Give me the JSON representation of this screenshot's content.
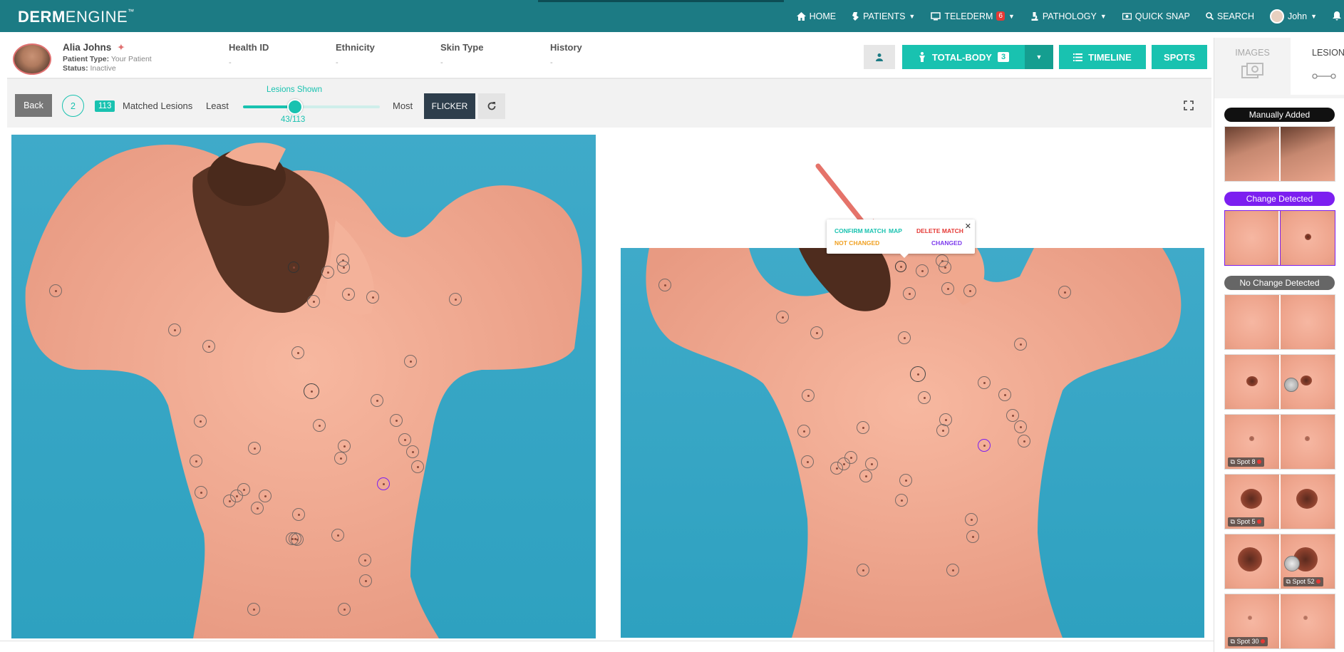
{
  "nav": {
    "logo_bold": "DERM",
    "logo_light": "ENGINE",
    "logo_tm": "™",
    "items": [
      {
        "label": "HOME",
        "icon": "home-icon"
      },
      {
        "label": "PATIENTS",
        "icon": "patients-icon",
        "caret": true
      },
      {
        "label": "TELEDERM",
        "icon": "telederm-icon",
        "badge": "6",
        "caret": true
      },
      {
        "label": "PATHOLOGY",
        "icon": "microscope-icon",
        "caret": true
      },
      {
        "label": "QUICK SNAP",
        "icon": "camera-icon"
      },
      {
        "label": "SEARCH",
        "icon": "search-icon"
      },
      {
        "label": "John",
        "icon": "user-avatar",
        "caret": true
      }
    ],
    "bell_icon": "bell-icon"
  },
  "patient": {
    "name": "Alia Johns",
    "type_label": "Patient Type:",
    "type_value": "Your Patient",
    "status_label": "Status:",
    "status_value": "Inactive",
    "columns": [
      {
        "label": "Health ID",
        "value": "-"
      },
      {
        "label": "Ethnicity",
        "value": "-"
      },
      {
        "label": "Skin Type",
        "value": "-"
      },
      {
        "label": "History",
        "value": "-"
      }
    ]
  },
  "actions": {
    "total_body_label": "TOTAL-BODY",
    "total_body_count": "3",
    "timeline_label": "TIMELINE",
    "spots_label": "SPOTS"
  },
  "toolbar": {
    "back_label": "Back",
    "step": "2",
    "matched_count": "113",
    "matched_label": "Matched Lesions",
    "least_label": "Least",
    "most_label": "Most",
    "lesions_shown_label": "Lesions Shown",
    "lesions_shown_value": "43/113",
    "lesions_shown_fraction": 0.38,
    "flicker_label": "FLICKER"
  },
  "popup": {
    "confirm": "CONFIRM MATCH",
    "map": "MAP",
    "delete": "DELETE MATCH",
    "not_changed": "NOT CHANGED",
    "changed": "CHANGED",
    "colors": {
      "confirm": "#19c2b0",
      "map": "#19c2b0",
      "delete": "#e53935",
      "not_changed": "#f0a020",
      "changed": "#7c3aed"
    }
  },
  "side_panel": {
    "tab_images": "IMAGES",
    "tab_lesions": "LESIONS",
    "sections": [
      {
        "label": "Manually Added",
        "color": "#111111"
      },
      {
        "label": "Change Detected",
        "color": "#7c1ff0"
      },
      {
        "label": "No Change Detected",
        "color": "#666666"
      }
    ],
    "spot_labels": [
      "Spot 8",
      "Spot 5",
      "Spot 52",
      "Spot 30"
    ]
  },
  "colors": {
    "nav_bg": "#1c7b84",
    "accent": "#19c2b0",
    "flicker_bg": "#2e3e4c",
    "annotation_arrow": "#e5736a"
  }
}
